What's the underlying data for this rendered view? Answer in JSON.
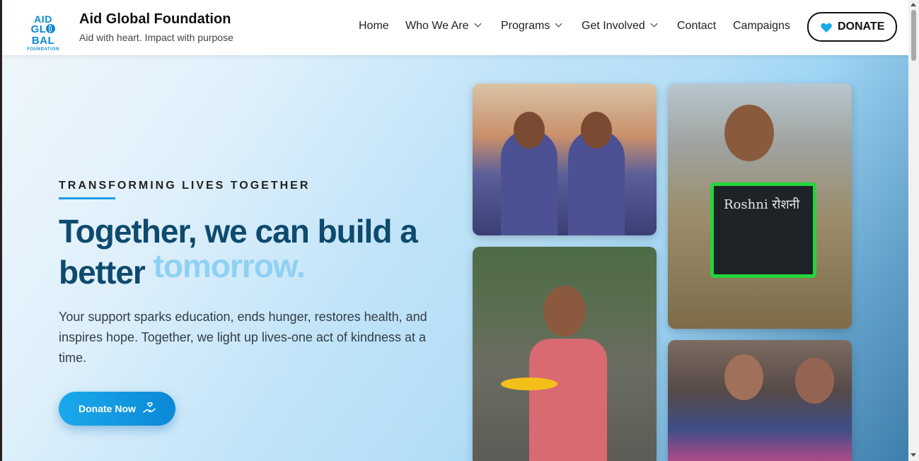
{
  "header": {
    "logo": {
      "line1": "AID",
      "line2_a": "GL",
      "line2_b": "BAL",
      "line3": "FOUNDATION"
    },
    "brand_name": "Aid Global Foundation",
    "tagline": "Aid with heart. Impact with purpose",
    "nav": {
      "home": "Home",
      "who_we_are": "Who We Are",
      "programs": "Programs",
      "get_involved": "Get Involved",
      "contact": "Contact",
      "campaigns": "Campaigns"
    },
    "donate_label": "DONATE"
  },
  "hero": {
    "eyebrow": "TRANSFORMING LIVES TOGETHER",
    "headline_main": "Together, we can build a better",
    "headline_accent": "tomorrow.",
    "description": "Your support sparks education, ends hunger, restores health, and inspires hope. Together, we light up lives-one act of kindness at a time.",
    "cta_label": "Donate Now"
  },
  "photos": {
    "board_text": "Roshni रोशनी"
  },
  "colors": {
    "brand_blue": "#0b88d6",
    "headline_navy": "#0e4a6e",
    "accent_light_blue": "#8fd1f4",
    "heart_blue": "#1aa9ec"
  },
  "icons": {
    "nav_dropdown": "chevron-down-icon",
    "donate": "heart-icon",
    "cta": "hand-holding-heart-icon"
  }
}
